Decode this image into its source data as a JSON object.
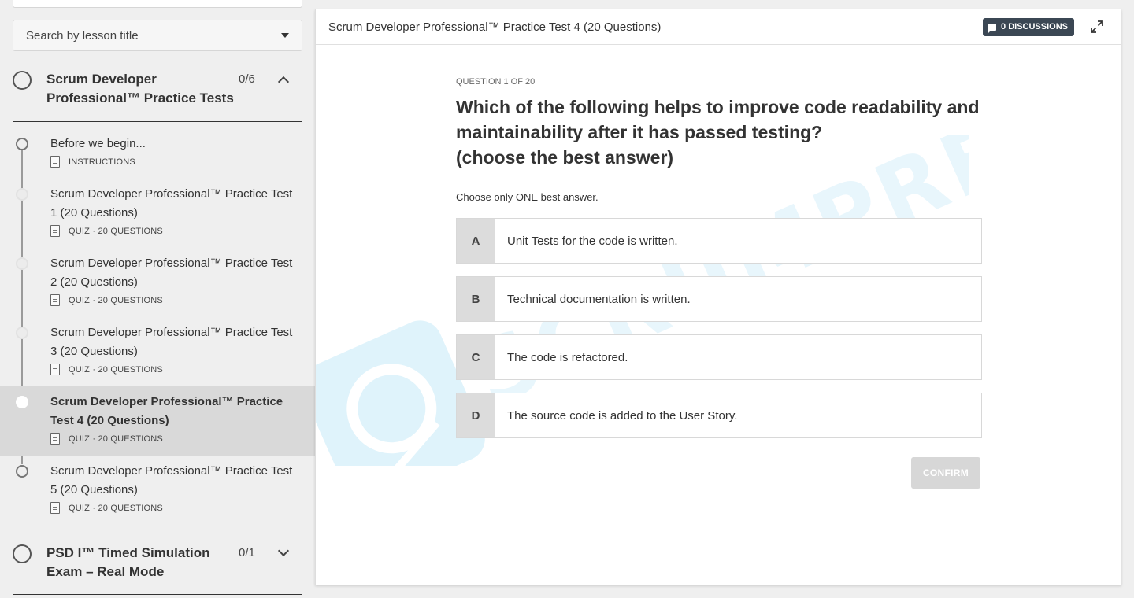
{
  "sidebar": {
    "search": {
      "placeholder": "Search by lesson title"
    },
    "sections": [
      {
        "title": "Scrum Developer Professional™ Practice Tests",
        "progress": "0/6",
        "expanded": true,
        "lessons": [
          {
            "title": "Before we begin...",
            "meta": "INSTRUCTIONS",
            "icon": "document-icon"
          },
          {
            "title": "Scrum Developer Professional™ Practice Test 1 (20 Questions)",
            "meta": "QUIZ · 20 QUESTIONS",
            "icon": "quiz-icon"
          },
          {
            "title": "Scrum Developer Professional™ Practice Test 2 (20 Questions)",
            "meta": "QUIZ · 20 QUESTIONS",
            "icon": "quiz-icon"
          },
          {
            "title": "Scrum Developer Professional™ Practice Test 3 (20 Questions)",
            "meta": "QUIZ · 20 QUESTIONS",
            "icon": "quiz-icon"
          },
          {
            "title": "Scrum Developer Professional™ Practice Test 4 (20 Questions)",
            "meta": "QUIZ · 20 QUESTIONS",
            "icon": "quiz-icon",
            "active": true
          },
          {
            "title": "Scrum Developer Professional™ Practice Test 5 (20 Questions)",
            "meta": "QUIZ · 20 QUESTIONS",
            "icon": "quiz-icon"
          }
        ]
      },
      {
        "title": "PSD I™ Timed Simulation Exam – Real Mode",
        "progress": "0/1",
        "expanded": false
      }
    ]
  },
  "main": {
    "title": "Scrum Developer Professional™ Practice Test 4 (20 Questions)",
    "discussions_label": "0 DISCUSSIONS",
    "question": {
      "number_label": "QUESTION 1 OF 20",
      "text_line1": "Which of the following helps to improve code readability and",
      "text_line2": "maintainability after it has passed testing?",
      "text_line3": "(choose the best answer)",
      "instruction": "Choose only ONE best answer.",
      "options": [
        {
          "letter": "A",
          "text": "Unit Tests for the code is written."
        },
        {
          "letter": "B",
          "text": "Technical documentation is written."
        },
        {
          "letter": "C",
          "text": "The code is refactored."
        },
        {
          "letter": "D",
          "text": "The source code is added to the User Story."
        }
      ],
      "confirm_label": "CONFIRM"
    },
    "watermark_text": "SCRUMPREP"
  },
  "colors": {
    "discussions_bg": "#3b4754",
    "active_lesson_bg": "#d9d9d9",
    "option_letter_bg": "#dcdcdc",
    "confirm_disabled_bg": "#d7d7d7",
    "watermark": "#dff3fb"
  }
}
